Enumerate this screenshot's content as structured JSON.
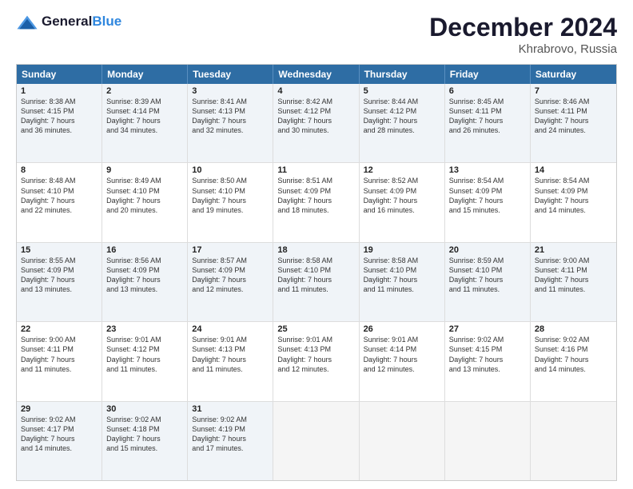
{
  "header": {
    "logo_line1": "General",
    "logo_line2": "Blue",
    "title": "December 2024",
    "location": "Khrabrovo, Russia"
  },
  "calendar": {
    "days_of_week": [
      "Sunday",
      "Monday",
      "Tuesday",
      "Wednesday",
      "Thursday",
      "Friday",
      "Saturday"
    ],
    "weeks": [
      [
        {
          "day": "",
          "empty": true
        },
        {
          "day": "",
          "empty": true
        },
        {
          "day": "",
          "empty": true
        },
        {
          "day": "",
          "empty": true
        },
        {
          "day": "",
          "empty": true
        },
        {
          "day": "",
          "empty": true
        },
        {
          "day": "",
          "empty": true
        }
      ],
      [
        {
          "num": "1",
          "lines": [
            "Sunrise: 8:38 AM",
            "Sunset: 4:15 PM",
            "Daylight: 7 hours",
            "and 36 minutes."
          ]
        },
        {
          "num": "2",
          "lines": [
            "Sunrise: 8:39 AM",
            "Sunset: 4:14 PM",
            "Daylight: 7 hours",
            "and 34 minutes."
          ]
        },
        {
          "num": "3",
          "lines": [
            "Sunrise: 8:41 AM",
            "Sunset: 4:13 PM",
            "Daylight: 7 hours",
            "and 32 minutes."
          ]
        },
        {
          "num": "4",
          "lines": [
            "Sunrise: 8:42 AM",
            "Sunset: 4:12 PM",
            "Daylight: 7 hours",
            "and 30 minutes."
          ]
        },
        {
          "num": "5",
          "lines": [
            "Sunrise: 8:44 AM",
            "Sunset: 4:12 PM",
            "Daylight: 7 hours",
            "and 28 minutes."
          ]
        },
        {
          "num": "6",
          "lines": [
            "Sunrise: 8:45 AM",
            "Sunset: 4:11 PM",
            "Daylight: 7 hours",
            "and 26 minutes."
          ]
        },
        {
          "num": "7",
          "lines": [
            "Sunrise: 8:46 AM",
            "Sunset: 4:11 PM",
            "Daylight: 7 hours",
            "and 24 minutes."
          ]
        }
      ],
      [
        {
          "num": "8",
          "lines": [
            "Sunrise: 8:48 AM",
            "Sunset: 4:10 PM",
            "Daylight: 7 hours",
            "and 22 minutes."
          ]
        },
        {
          "num": "9",
          "lines": [
            "Sunrise: 8:49 AM",
            "Sunset: 4:10 PM",
            "Daylight: 7 hours",
            "and 20 minutes."
          ]
        },
        {
          "num": "10",
          "lines": [
            "Sunrise: 8:50 AM",
            "Sunset: 4:10 PM",
            "Daylight: 7 hours",
            "and 19 minutes."
          ]
        },
        {
          "num": "11",
          "lines": [
            "Sunrise: 8:51 AM",
            "Sunset: 4:09 PM",
            "Daylight: 7 hours",
            "and 18 minutes."
          ]
        },
        {
          "num": "12",
          "lines": [
            "Sunrise: 8:52 AM",
            "Sunset: 4:09 PM",
            "Daylight: 7 hours",
            "and 16 minutes."
          ]
        },
        {
          "num": "13",
          "lines": [
            "Sunrise: 8:54 AM",
            "Sunset: 4:09 PM",
            "Daylight: 7 hours",
            "and 15 minutes."
          ]
        },
        {
          "num": "14",
          "lines": [
            "Sunrise: 8:54 AM",
            "Sunset: 4:09 PM",
            "Daylight: 7 hours",
            "and 14 minutes."
          ]
        }
      ],
      [
        {
          "num": "15",
          "lines": [
            "Sunrise: 8:55 AM",
            "Sunset: 4:09 PM",
            "Daylight: 7 hours",
            "and 13 minutes."
          ]
        },
        {
          "num": "16",
          "lines": [
            "Sunrise: 8:56 AM",
            "Sunset: 4:09 PM",
            "Daylight: 7 hours",
            "and 13 minutes."
          ]
        },
        {
          "num": "17",
          "lines": [
            "Sunrise: 8:57 AM",
            "Sunset: 4:09 PM",
            "Daylight: 7 hours",
            "and 12 minutes."
          ]
        },
        {
          "num": "18",
          "lines": [
            "Sunrise: 8:58 AM",
            "Sunset: 4:10 PM",
            "Daylight: 7 hours",
            "and 11 minutes."
          ]
        },
        {
          "num": "19",
          "lines": [
            "Sunrise: 8:58 AM",
            "Sunset: 4:10 PM",
            "Daylight: 7 hours",
            "and 11 minutes."
          ]
        },
        {
          "num": "20",
          "lines": [
            "Sunrise: 8:59 AM",
            "Sunset: 4:10 PM",
            "Daylight: 7 hours",
            "and 11 minutes."
          ]
        },
        {
          "num": "21",
          "lines": [
            "Sunrise: 9:00 AM",
            "Sunset: 4:11 PM",
            "Daylight: 7 hours",
            "and 11 minutes."
          ]
        }
      ],
      [
        {
          "num": "22",
          "lines": [
            "Sunrise: 9:00 AM",
            "Sunset: 4:11 PM",
            "Daylight: 7 hours",
            "and 11 minutes."
          ]
        },
        {
          "num": "23",
          "lines": [
            "Sunrise: 9:01 AM",
            "Sunset: 4:12 PM",
            "Daylight: 7 hours",
            "and 11 minutes."
          ]
        },
        {
          "num": "24",
          "lines": [
            "Sunrise: 9:01 AM",
            "Sunset: 4:13 PM",
            "Daylight: 7 hours",
            "and 11 minutes."
          ]
        },
        {
          "num": "25",
          "lines": [
            "Sunrise: 9:01 AM",
            "Sunset: 4:13 PM",
            "Daylight: 7 hours",
            "and 12 minutes."
          ]
        },
        {
          "num": "26",
          "lines": [
            "Sunrise: 9:01 AM",
            "Sunset: 4:14 PM",
            "Daylight: 7 hours",
            "and 12 minutes."
          ]
        },
        {
          "num": "27",
          "lines": [
            "Sunrise: 9:02 AM",
            "Sunset: 4:15 PM",
            "Daylight: 7 hours",
            "and 13 minutes."
          ]
        },
        {
          "num": "28",
          "lines": [
            "Sunrise: 9:02 AM",
            "Sunset: 4:16 PM",
            "Daylight: 7 hours",
            "and 14 minutes."
          ]
        }
      ],
      [
        {
          "num": "29",
          "lines": [
            "Sunrise: 9:02 AM",
            "Sunset: 4:17 PM",
            "Daylight: 7 hours",
            "and 14 minutes."
          ]
        },
        {
          "num": "30",
          "lines": [
            "Sunrise: 9:02 AM",
            "Sunset: 4:18 PM",
            "Daylight: 7 hours",
            "and 15 minutes."
          ]
        },
        {
          "num": "31",
          "lines": [
            "Sunrise: 9:02 AM",
            "Sunset: 4:19 PM",
            "Daylight: 7 hours",
            "and 17 minutes."
          ]
        },
        {
          "day": "",
          "empty": true
        },
        {
          "day": "",
          "empty": true
        },
        {
          "day": "",
          "empty": true
        },
        {
          "day": "",
          "empty": true
        }
      ]
    ]
  }
}
